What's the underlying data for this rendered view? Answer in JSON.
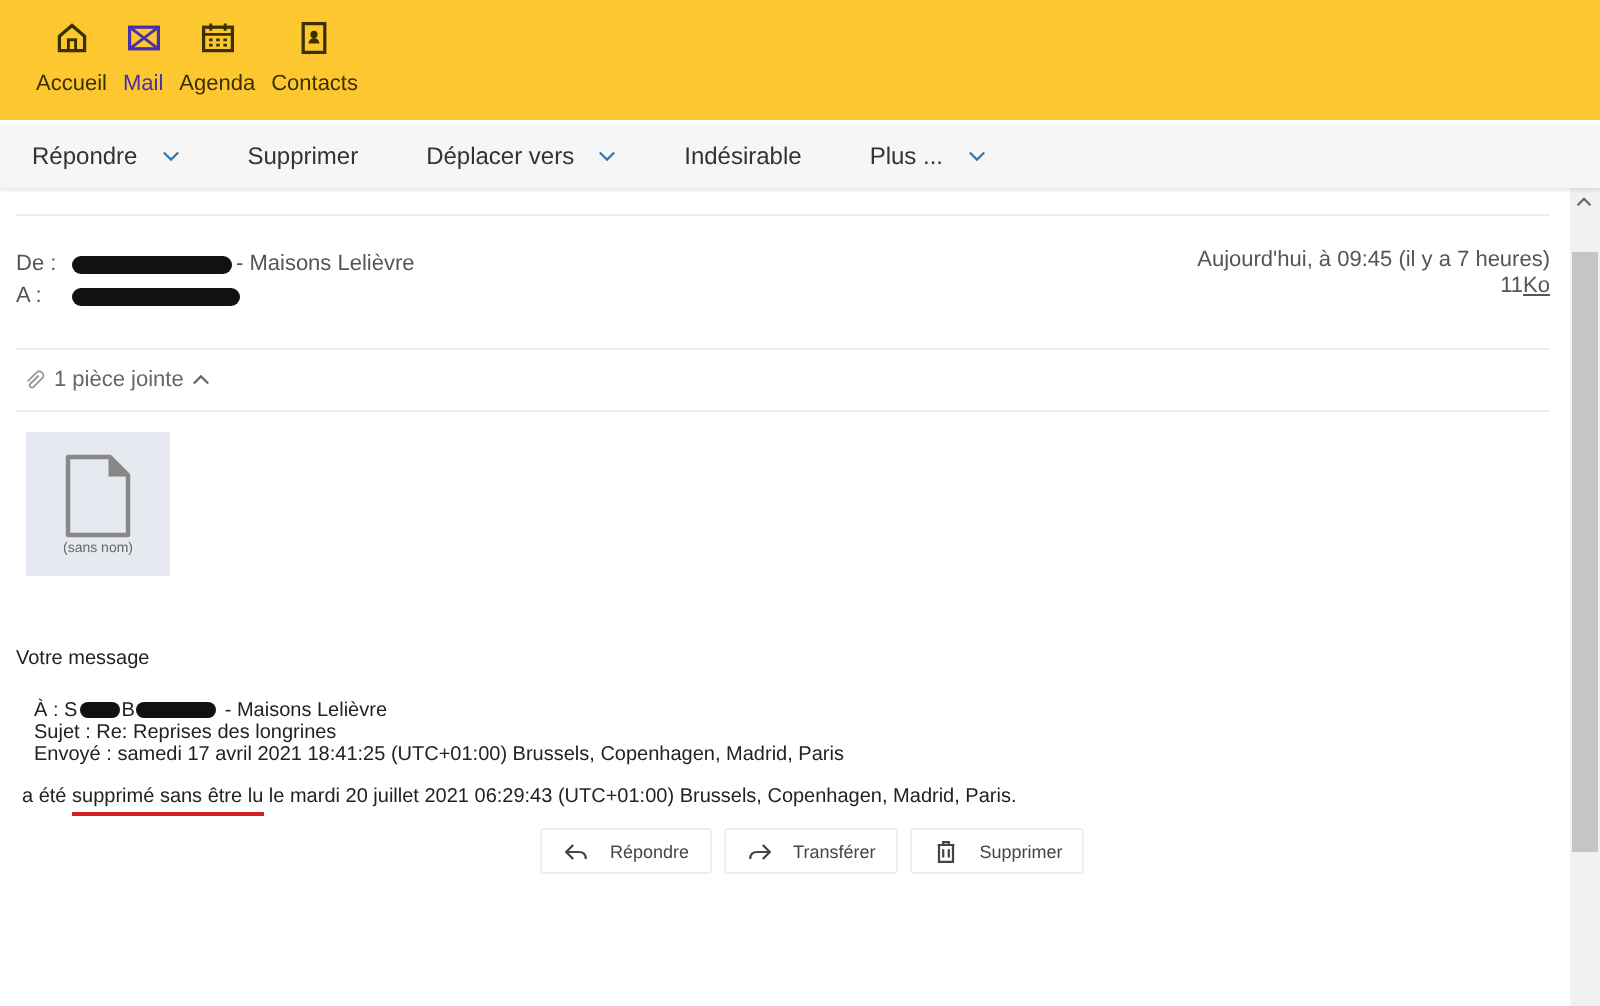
{
  "nav": [
    {
      "label": "Accueil",
      "selected": false
    },
    {
      "label": "Mail",
      "selected": true
    },
    {
      "label": "Agenda",
      "selected": false
    },
    {
      "label": "Contacts",
      "selected": false
    }
  ],
  "toolbar": [
    {
      "label": "Répondre",
      "dropdown": true
    },
    {
      "label": "Supprimer",
      "dropdown": false
    },
    {
      "label": "Déplacer vers",
      "dropdown": true
    },
    {
      "label": "Indésirable",
      "dropdown": false
    },
    {
      "label": "Plus ...",
      "dropdown": true
    }
  ],
  "header": {
    "from_label": "De :",
    "from_name": "- Maisons Lelièvre",
    "to_label": "A :",
    "date": "Aujourd'hui, à 09:45 (il y a 7 heures)",
    "size": "11",
    "size_unit": "Ko"
  },
  "attachments": {
    "summary": "1 pièce jointe",
    "expanded": true,
    "files": [
      {
        "name": "(sans nom)"
      }
    ]
  },
  "body": {
    "intro": "Votre message",
    "to_parts": [
      "À : S",
      "B",
      "- Maisons Lelièvre"
    ],
    "subject": "Sujet : Re: Reprises des longrines",
    "sent": "Envoyé : samedi 17 avril 2021 18:41:25 (UTC+01:00) Brussels, Copenhagen, Madrid, Paris",
    "sentence": [
      {
        "text": "a été ",
        "underlined": false
      },
      {
        "text": "supprimé sans être lu",
        "underlined": true
      },
      {
        "text": " le mardi 20 juillet 2021 06:29:43 (UTC+01:00) Brussels, Copenhagen, Madrid, Paris.",
        "underlined": false
      }
    ]
  },
  "actions": [
    {
      "label": "Répondre"
    },
    {
      "label": "Transférer"
    },
    {
      "label": "Supprimer"
    }
  ]
}
